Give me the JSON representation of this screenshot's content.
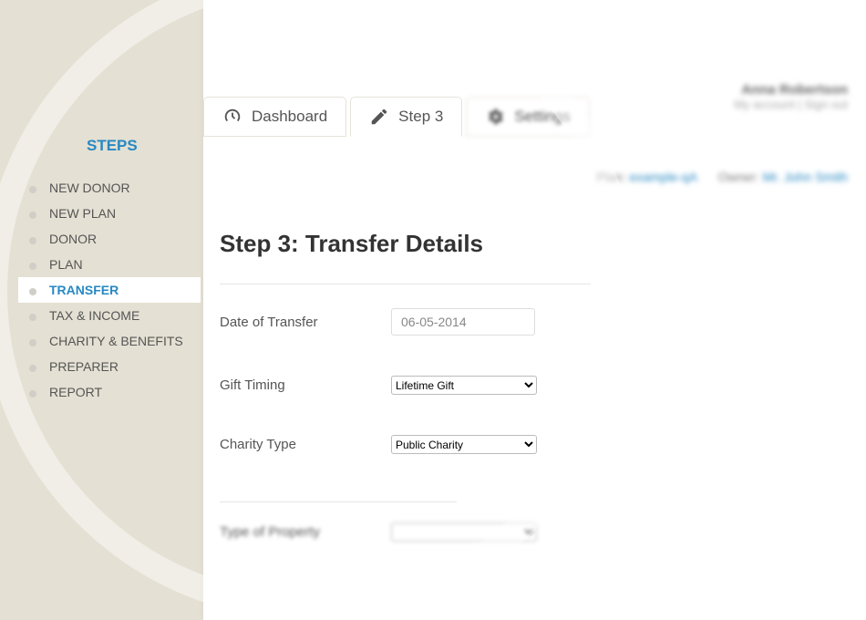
{
  "sidebar": {
    "title": "STEPS",
    "items": [
      {
        "label": "NEW DONOR",
        "active": false
      },
      {
        "label": "NEW PLAN",
        "active": false
      },
      {
        "label": "DONOR",
        "active": false
      },
      {
        "label": "PLAN",
        "active": false
      },
      {
        "label": "TRANSFER",
        "active": true
      },
      {
        "label": "TAX & INCOME",
        "active": false
      },
      {
        "label": "CHARITY & BENEFITS",
        "active": false
      },
      {
        "label": "PREPARER",
        "active": false
      },
      {
        "label": "REPORT",
        "active": false
      }
    ]
  },
  "tabs": [
    {
      "label": "Dashboard",
      "icon": "dashboard-icon",
      "active": false,
      "blurred": false
    },
    {
      "label": "Step 3",
      "icon": "pencil-icon",
      "active": true,
      "blurred": false
    },
    {
      "label": "Settings",
      "icon": "gears-icon",
      "active": false,
      "blurred": true
    }
  ],
  "userHeader": {
    "name": "Anna Robertson",
    "linksText": "My account | Sign out"
  },
  "metaLine": {
    "planLabel": "Plan:",
    "planValue": "example-qA",
    "ownerLabel": "Owner:",
    "ownerValue": "Mr. John Smith"
  },
  "page": {
    "title": "Step 3: Transfer Details",
    "fields": {
      "dateOfTransfer": {
        "label": "Date of Transfer",
        "value": "06-05-2014"
      },
      "giftTiming": {
        "label": "Gift Timing",
        "value": "Lifetime Gift"
      },
      "charityType": {
        "label": "Charity Type",
        "value": "Public Charity"
      },
      "typeOfProperty": {
        "label": "Type of Property",
        "value": ""
      }
    }
  }
}
